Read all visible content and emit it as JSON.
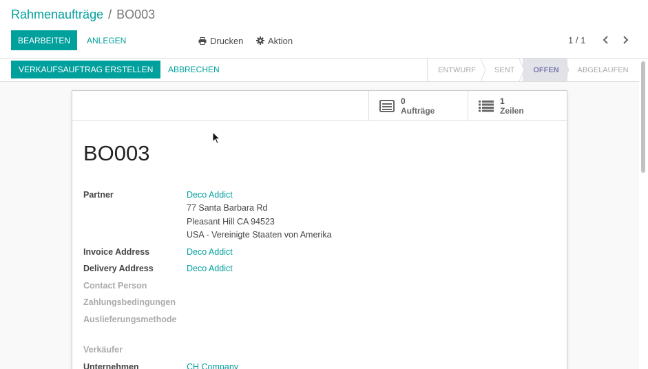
{
  "breadcrumb": {
    "parent": "Rahmenaufträge",
    "separator": "/",
    "current": "BO003"
  },
  "toolbar": {
    "edit_label": "Bearbeiten",
    "create_label": "Anlegen",
    "print_label": "Drucken",
    "action_label": "Aktion"
  },
  "pager": {
    "value": "1 / 1"
  },
  "statusbar": {
    "create_sale_label": "Verkaufsauftrag erstellen",
    "cancel_label": "Abbrechen",
    "states": [
      "Entwurf",
      "Sent",
      "Offen",
      "Abgelaufen"
    ],
    "active_state": "Offen"
  },
  "smart_buttons": [
    {
      "count": "0",
      "label": "Aufträge",
      "icon": "list-alt-icon"
    },
    {
      "count": "1",
      "label": "Zeilen",
      "icon": "list-icon"
    }
  ],
  "record": {
    "title": "BO003",
    "partner_label": "Partner",
    "partner_value": "Deco Addict",
    "partner_address_1": "77 Santa Barbara Rd",
    "partner_address_2": "Pleasant Hill CA 94523",
    "partner_address_3": "USA - Vereinigte Staaten von Amerika",
    "invoice_label": "Invoice Address",
    "invoice_value": "Deco Addict",
    "delivery_label": "Delivery Address",
    "delivery_value": "Deco Addict",
    "contact_label": "Contact Person",
    "payment_terms_label": "Zahlungsbedingungen",
    "shipping_method_label": "Auslieferungsmethode",
    "salesperson_label": "Verkäufer",
    "company_label": "Unternehmen",
    "company_value": "CH Company"
  },
  "colors": {
    "accent": "#00a09d",
    "active_state_bg": "#e2e2e9",
    "active_state_text": "#7c7bad"
  }
}
